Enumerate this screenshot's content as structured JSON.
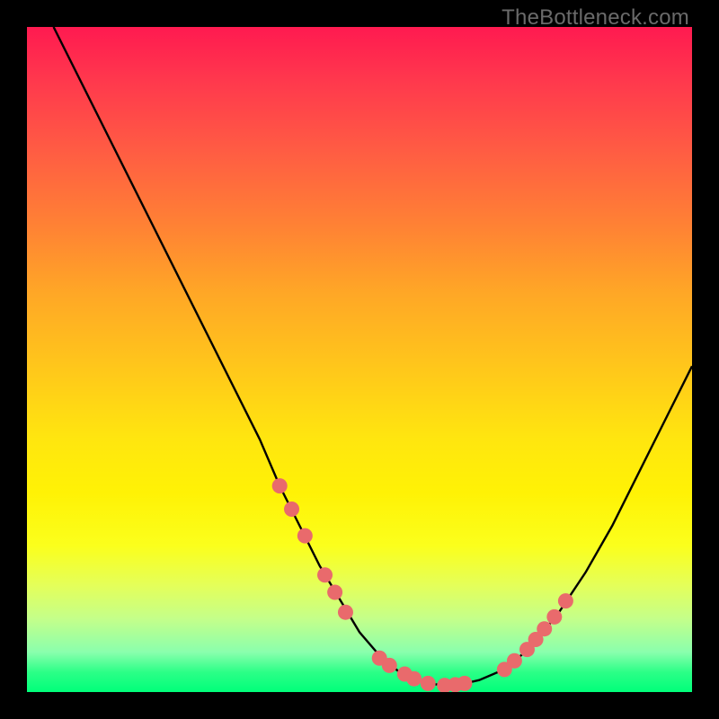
{
  "watermark": "TheBottleneck.com",
  "colors": {
    "frame": "#000000",
    "curve_stroke": "#000000",
    "marker_fill": "#e96a6c",
    "gradient_top": "#ff1a50",
    "gradient_bottom": "#00ff7a"
  },
  "chart_data": {
    "type": "line",
    "title": "",
    "xlabel": "",
    "ylabel": "",
    "xlim": [
      0,
      100
    ],
    "ylim": [
      0,
      100
    ],
    "series": [
      {
        "name": "curve",
        "x": [
          4,
          10,
          15,
          20,
          25,
          30,
          35,
          38,
          41,
          44,
          47,
          50,
          53,
          56,
          59,
          61,
          63,
          65,
          68,
          72,
          76,
          80,
          84,
          88,
          92,
          96,
          100
        ],
        "y": [
          100,
          88,
          78,
          68,
          58,
          48,
          38,
          31,
          25,
          19,
          14,
          9,
          5.5,
          3,
          1.7,
          1.2,
          1.0,
          1.1,
          1.8,
          3.5,
          7,
          12,
          18,
          25,
          33,
          41,
          49
        ]
      }
    ],
    "curve_min_x": 62,
    "markers_left": [
      {
        "x": 38.0,
        "y": 31.0
      },
      {
        "x": 39.8,
        "y": 27.5
      },
      {
        "x": 41.8,
        "y": 23.5
      },
      {
        "x": 44.8,
        "y": 17.6
      },
      {
        "x": 46.3,
        "y": 15.0
      },
      {
        "x": 47.9,
        "y": 12.0
      }
    ],
    "markers_bottom": [
      {
        "x": 53.0,
        "y": 5.1
      },
      {
        "x": 54.5,
        "y": 4.0
      },
      {
        "x": 56.8,
        "y": 2.7
      },
      {
        "x": 58.2,
        "y": 2.0
      },
      {
        "x": 60.3,
        "y": 1.3
      },
      {
        "x": 62.8,
        "y": 1.0
      },
      {
        "x": 64.4,
        "y": 1.1
      },
      {
        "x": 65.8,
        "y": 1.3
      }
    ],
    "markers_right": [
      {
        "x": 71.8,
        "y": 3.4
      },
      {
        "x": 73.3,
        "y": 4.7
      },
      {
        "x": 75.2,
        "y": 6.4
      },
      {
        "x": 76.5,
        "y": 7.9
      },
      {
        "x": 77.8,
        "y": 9.5
      },
      {
        "x": 79.3,
        "y": 11.3
      },
      {
        "x": 81.0,
        "y": 13.7
      }
    ]
  }
}
